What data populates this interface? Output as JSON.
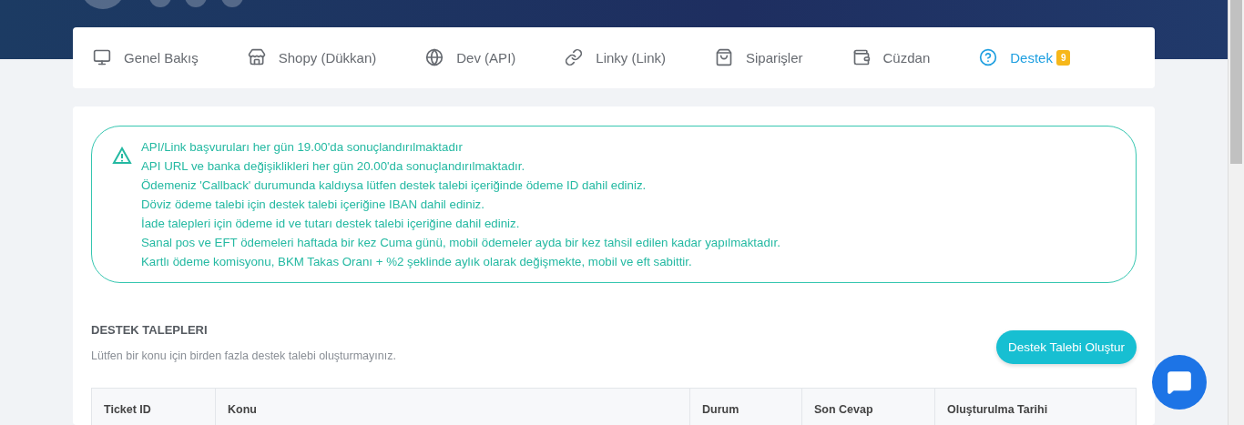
{
  "nav": [
    {
      "label": "Genel Bakış",
      "selected": false
    },
    {
      "label": "Shopy (Dükkan)",
      "selected": false
    },
    {
      "label": "Dev (API)",
      "selected": false
    },
    {
      "label": "Linky (Link)",
      "selected": false
    },
    {
      "label": "Siparişler",
      "selected": false
    },
    {
      "label": "Cüzdan",
      "selected": false
    },
    {
      "label": "Destek",
      "selected": true,
      "badge": "9"
    }
  ],
  "notice": {
    "lines": [
      "API/Link başvuruları her gün 19.00'da sonuçlandırılmaktadır",
      "API URL ve banka değişiklikleri her gün 20.00'da sonuçlandırılmaktadır.",
      "Ödemeniz 'Callback' durumunda kaldıysa lütfen destek talebi içeriğinde ödeme ID dahil ediniz.",
      "Döviz ödeme talebi için destek talebi içeriğine IBAN dahil ediniz.",
      "İade talepleri için ödeme id ve tutarı destek talebi içeriğine dahil ediniz.",
      "Sanal pos ve EFT ödemeleri haftada bir kez Cuma günü, mobil ödemeler ayda bir kez tahsil edilen kadar yapılmaktadır.",
      "Kartlı ödeme komisyonu, BKM Takas Oranı + %2 şeklinde aylık olarak değişmekte, mobil ve eft sabittir."
    ]
  },
  "tickets": {
    "title": "DESTEK TALEPLERI",
    "subtitle": "Lütfen bir konu için birden fazla destek talebi oluşturmayınız.",
    "create_button": "Destek Talebi Oluştur",
    "columns": [
      "Ticket ID",
      "Konu",
      "Durum",
      "Son Cevap",
      "Oluşturulma Tarihi"
    ]
  }
}
